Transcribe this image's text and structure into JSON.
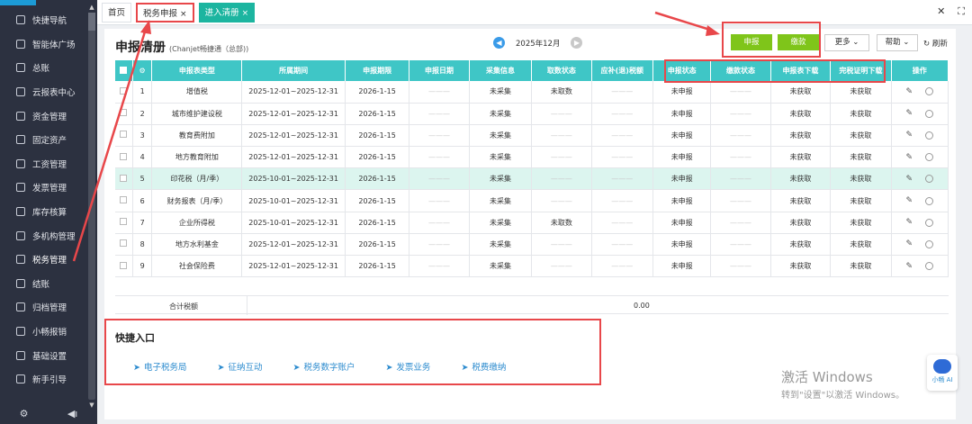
{
  "sidebar": {
    "items": [
      {
        "label": "快捷导航",
        "icon": "home-icon"
      },
      {
        "label": "智能体广场",
        "icon": "chart-icon"
      },
      {
        "label": "总账",
        "icon": "ledger-icon"
      },
      {
        "label": "云报表中心",
        "icon": "report-icon"
      },
      {
        "label": "资金管理",
        "icon": "money-icon"
      },
      {
        "label": "固定资产",
        "icon": "asset-icon"
      },
      {
        "label": "工资管理",
        "icon": "salary-icon"
      },
      {
        "label": "发票管理",
        "icon": "invoice-icon"
      },
      {
        "label": "库存核算",
        "icon": "inventory-icon"
      },
      {
        "label": "多机构管理",
        "icon": "org-icon"
      },
      {
        "label": "税务管理",
        "icon": "tax-icon"
      },
      {
        "label": "结账",
        "icon": "close-book-icon"
      },
      {
        "label": "归档管理",
        "icon": "archive-icon"
      },
      {
        "label": "小畅报销",
        "icon": "reimburse-icon"
      },
      {
        "label": "基础设置",
        "icon": "settings-icon"
      },
      {
        "label": "新手引导",
        "icon": "guide-icon"
      }
    ]
  },
  "tabs": [
    {
      "label": "首页",
      "closable": false
    },
    {
      "label": "税务申报",
      "closable": true,
      "active": true
    },
    {
      "label": "进入清册",
      "closable": true
    }
  ],
  "header": {
    "title": "申报清册",
    "subtitle": "(Chanjet畅捷通（总部))",
    "period": "2025年12月",
    "buttons": {
      "declare": "申报",
      "pay": "缴款",
      "more": "更多",
      "help": "帮助",
      "refresh": "刷新"
    }
  },
  "table": {
    "columns": [
      "申报表类型",
      "所属期间",
      "申报期限",
      "申报日期",
      "采集信息",
      "取数状态",
      "应补(退)税额",
      "申报状态",
      "缴款状态",
      "申报表下载",
      "完税证明下载",
      "操作"
    ],
    "rows": [
      {
        "no": "1",
        "type": "增值税",
        "period": "2025-12-01~2025-12-31",
        "deadline": "2026-1-15",
        "date": "———",
        "collect": "未采集",
        "fetch": "未取数",
        "amount": "———",
        "declare": "未申报",
        "pay": "———",
        "dl": "未获取",
        "cert": "未获取"
      },
      {
        "no": "2",
        "type": "城市维护建设税",
        "period": "2025-12-01~2025-12-31",
        "deadline": "2026-1-15",
        "date": "———",
        "collect": "未采集",
        "fetch": "———",
        "amount": "———",
        "declare": "未申报",
        "pay": "———",
        "dl": "未获取",
        "cert": "未获取"
      },
      {
        "no": "3",
        "type": "教育费附加",
        "period": "2025-12-01~2025-12-31",
        "deadline": "2026-1-15",
        "date": "———",
        "collect": "未采集",
        "fetch": "———",
        "amount": "———",
        "declare": "未申报",
        "pay": "———",
        "dl": "未获取",
        "cert": "未获取"
      },
      {
        "no": "4",
        "type": "地方教育附加",
        "period": "2025-12-01~2025-12-31",
        "deadline": "2026-1-15",
        "date": "———",
        "collect": "未采集",
        "fetch": "———",
        "amount": "———",
        "declare": "未申报",
        "pay": "———",
        "dl": "未获取",
        "cert": "未获取"
      },
      {
        "no": "5",
        "type": "印花税（月/季）",
        "period": "2025-10-01~2025-12-31",
        "deadline": "2026-1-15",
        "date": "———",
        "collect": "未采集",
        "fetch": "———",
        "amount": "———",
        "declare": "未申报",
        "pay": "———",
        "dl": "未获取",
        "cert": "未获取"
      },
      {
        "no": "6",
        "type": "财务报表（月/季）",
        "period": "2025-10-01~2025-12-31",
        "deadline": "2026-1-15",
        "date": "———",
        "collect": "未采集",
        "fetch": "———",
        "amount": "———",
        "declare": "未申报",
        "pay": "———",
        "dl": "未获取",
        "cert": "未获取"
      },
      {
        "no": "7",
        "type": "企业所得税",
        "period": "2025-10-01~2025-12-31",
        "deadline": "2026-1-15",
        "date": "———",
        "collect": "未采集",
        "fetch": "未取数",
        "amount": "———",
        "declare": "未申报",
        "pay": "———",
        "dl": "未获取",
        "cert": "未获取"
      },
      {
        "no": "8",
        "type": "地方水利基金",
        "period": "2025-12-01~2025-12-31",
        "deadline": "2026-1-15",
        "date": "———",
        "collect": "未采集",
        "fetch": "———",
        "amount": "———",
        "declare": "未申报",
        "pay": "———",
        "dl": "未获取",
        "cert": "未获取"
      },
      {
        "no": "9",
        "type": "社会保险费",
        "period": "2025-12-01~2025-12-31",
        "deadline": "2026-1-15",
        "date": "———",
        "collect": "未采集",
        "fetch": "———",
        "amount": "———",
        "declare": "未申报",
        "pay": "———",
        "dl": "未获取",
        "cert": "未获取"
      }
    ],
    "highlight_row": 5,
    "total_label": "合计税额",
    "total_value": "0.00"
  },
  "quick": {
    "title": "快捷入口",
    "links": [
      "电子税务局",
      "征纳互动",
      "税务数字账户",
      "发票业务",
      "税费缴纳"
    ]
  },
  "watermark": {
    "line1": "激活 Windows",
    "line2": "转到\"设置\"以激活 Windows。"
  },
  "ai_widget": {
    "label": "小畅 AI"
  },
  "colors": {
    "accent": "#3fc6c6",
    "sidebar": "#2c3140",
    "green_button": "#7fc51a",
    "annotation_red": "#e8474a",
    "link": "#2e8ccf"
  }
}
